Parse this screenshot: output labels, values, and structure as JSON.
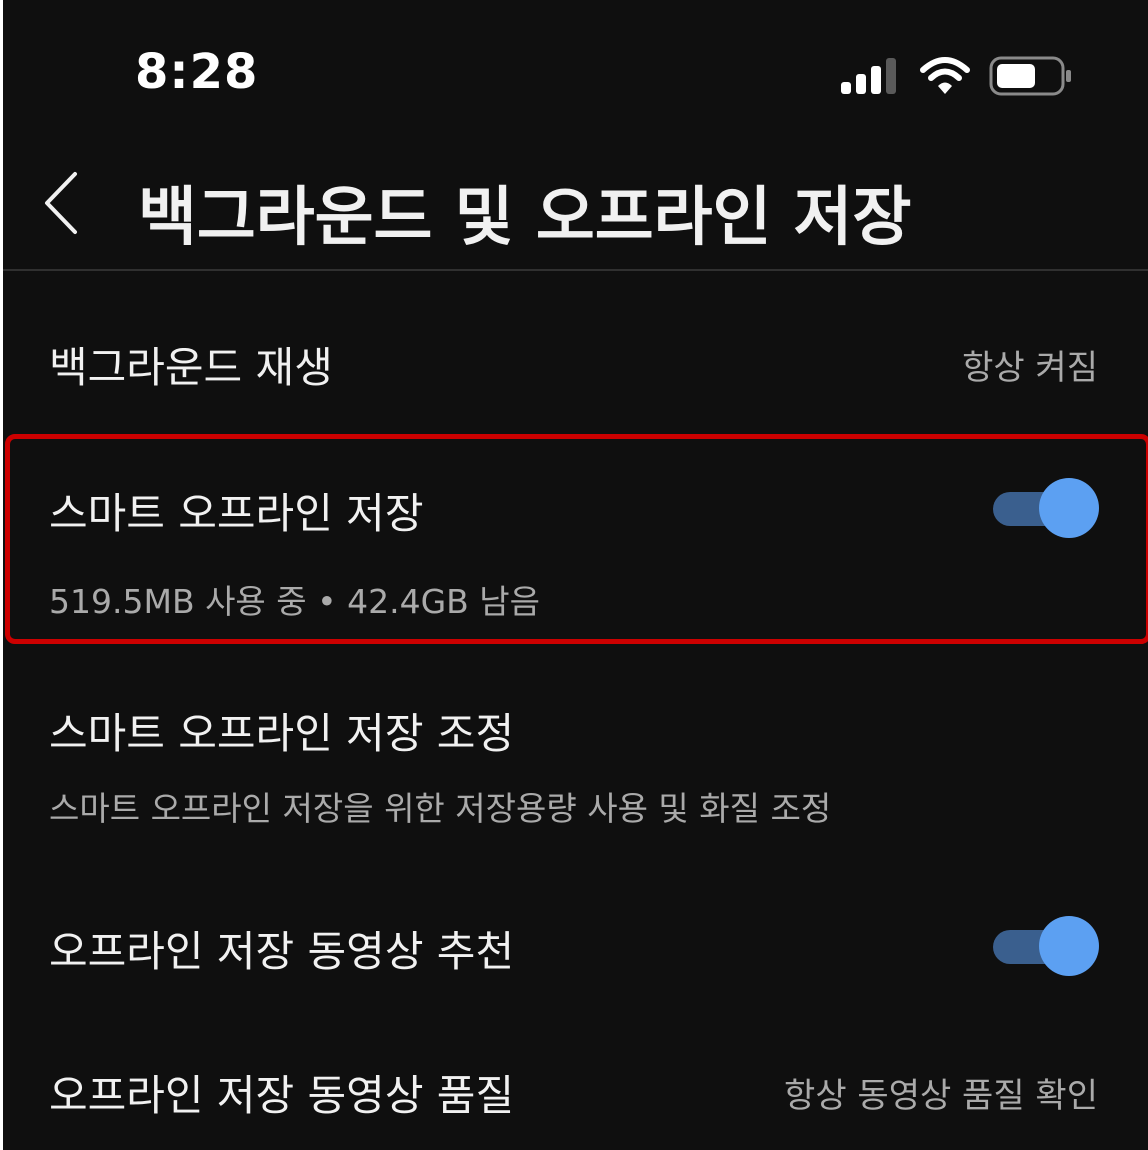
{
  "status_bar": {
    "time": "8:28",
    "icons": [
      "signal-icon",
      "wifi-icon",
      "battery-icon"
    ]
  },
  "header": {
    "back_icon": "chevron-left-icon",
    "title": "백그라운드 및 오프라인 저장"
  },
  "settings": {
    "background_play": {
      "title": "백그라운드 재생",
      "value": "항상 켜짐"
    },
    "smart_offline": {
      "title": "스마트 오프라인 저장",
      "subtitle": "519.5MB 사용 중 • 42.4GB 남음",
      "toggle_on": true
    },
    "smart_offline_adjust": {
      "title": "스마트 오프라인 저장 조정",
      "subtitle": "스마트 오프라인 저장을 위한 저장용량 사용 및 화질 조정"
    },
    "offline_recommend": {
      "title": "오프라인 저장 동영상 추천",
      "toggle_on": true
    },
    "offline_quality": {
      "title": "오프라인 저장 동영상 품질",
      "value": "항상 동영상 품질 확인"
    }
  },
  "colors": {
    "background": "#0f0f0f",
    "toggle_track": "#3a5f8e",
    "toggle_knob": "#5ca0f2",
    "highlight": "#cc0000"
  }
}
